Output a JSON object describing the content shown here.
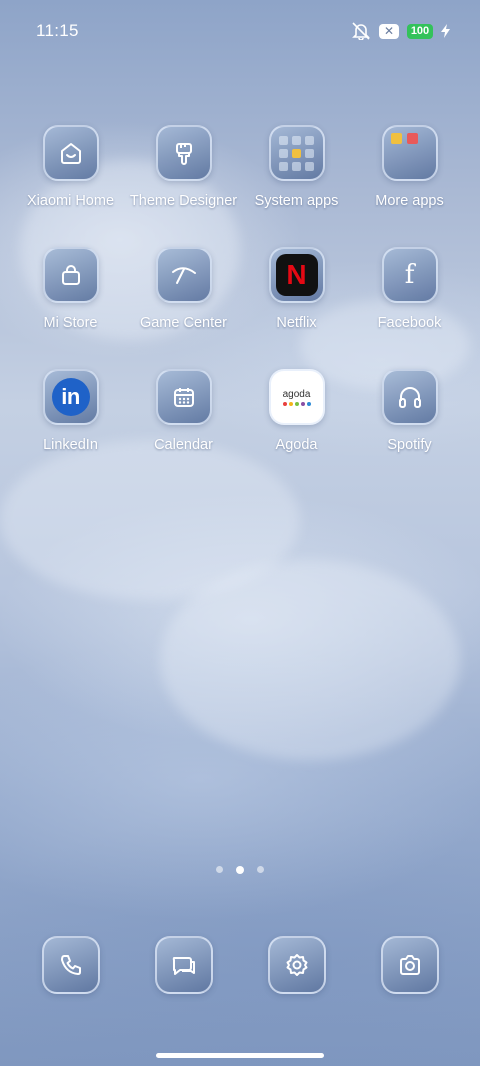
{
  "status_bar": {
    "time": "11:15",
    "icons": [
      "mute-icon",
      "notification-badge",
      "battery-icon",
      "charging-icon"
    ],
    "notification_badge": "✕",
    "battery": "100"
  },
  "apps": [
    {
      "label": "Xiaomi Home",
      "icon": "xiaomi-home-icon"
    },
    {
      "label": "Theme Designer",
      "icon": "theme-brush-icon"
    },
    {
      "label": "System apps",
      "icon": "folder-icon"
    },
    {
      "label": "More apps",
      "icon": "folder-icon"
    },
    {
      "label": "Mi Store",
      "icon": "shopping-bag-icon"
    },
    {
      "label": "Game Center",
      "icon": "game-center-icon"
    },
    {
      "label": "Netflix",
      "icon": "netflix-icon",
      "glyph": "N"
    },
    {
      "label": "Facebook",
      "icon": "facebook-icon",
      "glyph": "f"
    },
    {
      "label": "LinkedIn",
      "icon": "linkedin-icon",
      "glyph": "in"
    },
    {
      "label": "Calendar",
      "icon": "calendar-icon"
    },
    {
      "label": "Agoda",
      "icon": "agoda-icon",
      "glyph": "agoda"
    },
    {
      "label": "Spotify",
      "icon": "headphones-icon"
    }
  ],
  "page_indicator": {
    "pages": 3,
    "current": 2
  },
  "dock": [
    {
      "name": "phone",
      "icon": "phone-icon"
    },
    {
      "name": "messages",
      "icon": "messages-icon"
    },
    {
      "name": "settings",
      "icon": "gear-icon"
    },
    {
      "name": "camera",
      "icon": "camera-icon"
    }
  ],
  "colors": {
    "battery": "#33c25a",
    "netflix_red": "#e50914",
    "linkedin_blue": "#1f62c8",
    "icon_tint": "#7a8fb5"
  }
}
